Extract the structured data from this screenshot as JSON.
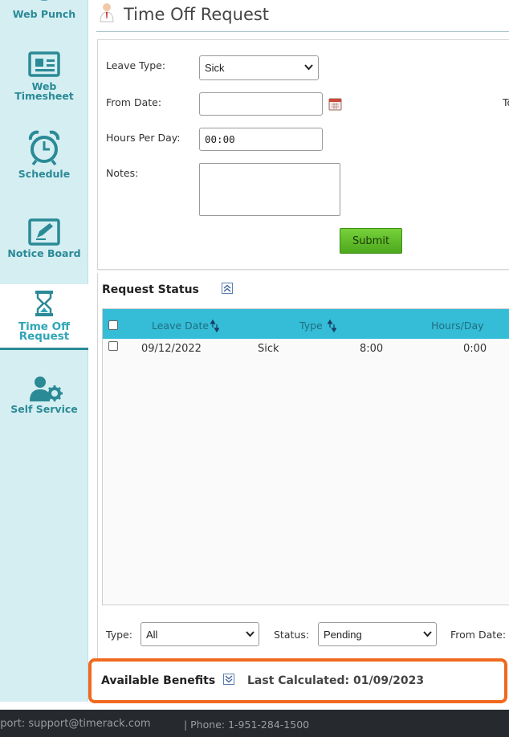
{
  "sidebar": {
    "items": [
      {
        "label": "Web Punch",
        "icon": "clock-punch-icon",
        "active": false
      },
      {
        "label": "Web",
        "label2": "Timesheet",
        "icon": "timesheet-card-icon",
        "active": false
      },
      {
        "label": "Schedule",
        "icon": "alarm-clock-icon",
        "active": false
      },
      {
        "label": "Notice Board",
        "icon": "notice-board-icon",
        "active": false
      },
      {
        "label": "Time Off",
        "label2": "Request",
        "icon": "hourglass-icon",
        "active": true
      },
      {
        "label": "Self Service",
        "icon": "user-gear-icon",
        "active": false
      }
    ]
  },
  "header": {
    "title": "Time Off Request"
  },
  "form": {
    "leave_type_label": "Leave Type:",
    "leave_type_value": "Sick",
    "from_date_label": "From Date:",
    "from_date_value": "",
    "to_date_label_partial": "To",
    "hours_per_day_label": "Hours Per Day:",
    "hours_per_day_value": "00:00",
    "notes_label": "Notes:",
    "notes_value": "",
    "submit_label": "Submit"
  },
  "request_status": {
    "title": "Request Status",
    "columns": [
      "Leave Date",
      "Type",
      "Hours/Day"
    ],
    "rows": [
      {
        "leave_date": "09/12/2022",
        "type": "Sick",
        "hours": "8:00",
        "extra": "0:00"
      }
    ]
  },
  "filters": {
    "type_label": "Type:",
    "type_value": "All",
    "status_label": "Status:",
    "status_value": "Pending",
    "from_date_label": "From Date:"
  },
  "benefits": {
    "title": "Available Benefits",
    "last_calculated": "Last Calculated: 01/09/2023"
  },
  "footer": {
    "support_text": "pport: support@timerack.com",
    "phone_text": "| Phone: 1-951-284-1500"
  },
  "colors": {
    "accent_teal": "#2a8a96",
    "table_header": "#35bcd6",
    "submit_green": "#5bb82a",
    "highlight_orange": "#f06a1e",
    "footer_bg": "#262a2e"
  }
}
